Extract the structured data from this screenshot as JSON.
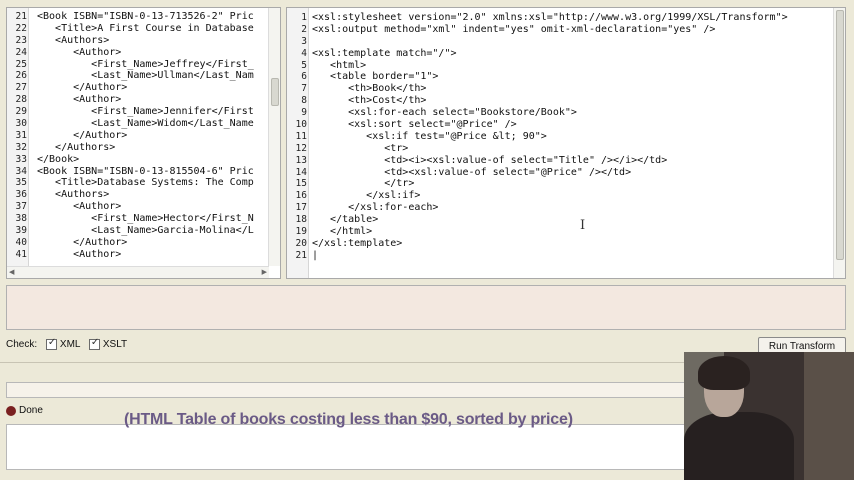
{
  "left_editor": {
    "lines": [
      {
        "n": "21",
        "t": "<Book ISBN=\"ISBN-0-13-713526-2\" Pric"
      },
      {
        "n": "22",
        "t": "   <Title>A First Course in Database"
      },
      {
        "n": "23",
        "t": "   <Authors>"
      },
      {
        "n": "24",
        "t": "      <Author>"
      },
      {
        "n": "25",
        "t": "         <First_Name>Jeffrey</First_"
      },
      {
        "n": "26",
        "t": "         <Last_Name>Ullman</Last_Nam"
      },
      {
        "n": "27",
        "t": "      </Author>"
      },
      {
        "n": "28",
        "t": "      <Author>"
      },
      {
        "n": "29",
        "t": "         <First_Name>Jennifer</First"
      },
      {
        "n": "30",
        "t": "         <Last_Name>Widom</Last_Name"
      },
      {
        "n": "31",
        "t": "      </Author>"
      },
      {
        "n": "32",
        "t": "   </Authors>"
      },
      {
        "n": "33",
        "t": "</Book>"
      },
      {
        "n": "34",
        "t": "<Book ISBN=\"ISBN-0-13-815504-6\" Pric"
      },
      {
        "n": "35",
        "t": "   <Title>Database Systems: The Comp"
      },
      {
        "n": "36",
        "t": "   <Authors>"
      },
      {
        "n": "37",
        "t": "      <Author>"
      },
      {
        "n": "38",
        "t": "         <First_Name>Hector</First_N"
      },
      {
        "n": "39",
        "t": "         <Last_Name>Garcia-Molina</L"
      },
      {
        "n": "40",
        "t": "      </Author>"
      },
      {
        "n": "41",
        "t": "      <Author>"
      }
    ]
  },
  "right_editor": {
    "lines": [
      {
        "n": "1",
        "t": "<xsl:stylesheet version=\"2.0\" xmlns:xsl=\"http://www.w3.org/1999/XSL/Transform\">"
      },
      {
        "n": "2",
        "t": "<xsl:output method=\"xml\" indent=\"yes\" omit-xml-declaration=\"yes\" />"
      },
      {
        "n": "3",
        "t": ""
      },
      {
        "n": "4",
        "t": "<xsl:template match=\"/\">"
      },
      {
        "n": "5",
        "t": "   <html>"
      },
      {
        "n": "6",
        "t": "   <table border=\"1\">"
      },
      {
        "n": "7",
        "t": "      <th>Book</th>"
      },
      {
        "n": "8",
        "t": "      <th>Cost</th>"
      },
      {
        "n": "9",
        "t": "      <xsl:for-each select=\"Bookstore/Book\">"
      },
      {
        "n": "10",
        "t": "      <xsl:sort select=\"@Price\" />"
      },
      {
        "n": "11",
        "t": "         <xsl:if test=\"@Price &lt; 90\">"
      },
      {
        "n": "12",
        "t": "            <tr>"
      },
      {
        "n": "13",
        "t": "            <td><i><xsl:value-of select=\"Title\" /></i></td>"
      },
      {
        "n": "14",
        "t": "            <td><xsl:value-of select=\"@Price\" /></td>"
      },
      {
        "n": "15",
        "t": "            </tr>"
      },
      {
        "n": "16",
        "t": "         </xsl:if>"
      },
      {
        "n": "17",
        "t": "      </xsl:for-each>"
      },
      {
        "n": "18",
        "t": "   </table>"
      },
      {
        "n": "19",
        "t": "   </html>"
      },
      {
        "n": "20",
        "t": "</xsl:template>"
      },
      {
        "n": "21",
        "t": "|"
      }
    ]
  },
  "controls": {
    "check_label": "Check:",
    "xml_label": "XML",
    "xslt_label": "XSLT",
    "xml_checked": true,
    "xslt_checked": true,
    "run_button": "Run Transform"
  },
  "status": {
    "text": "Done"
  },
  "caption": "(HTML Table of books costing less than $90, sorted by price)"
}
